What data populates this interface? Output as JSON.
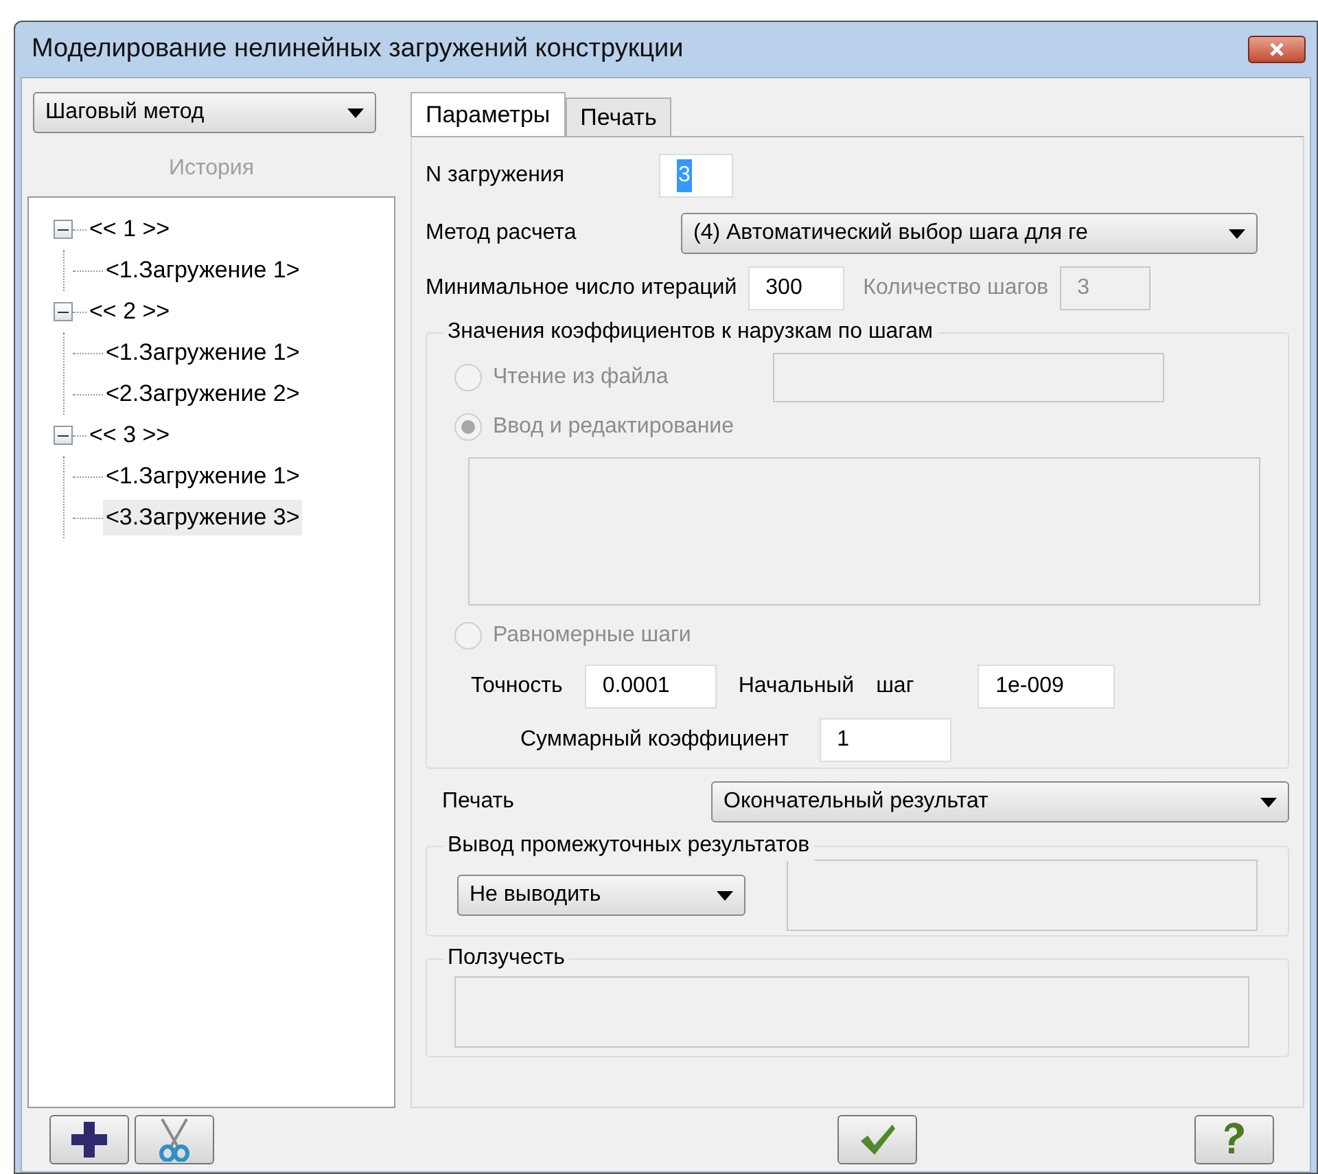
{
  "window": {
    "title": "Моделирование нелинейных загружений конструкции"
  },
  "method_dropdown": {
    "value": "Шаговый метод"
  },
  "history": {
    "label": "История",
    "tree": [
      {
        "label": "<< 1 >>",
        "expanded": true,
        "selected": false,
        "children": [
          {
            "label": "<1.Загружение 1>",
            "selected": false
          }
        ]
      },
      {
        "label": "<< 2 >>",
        "expanded": true,
        "selected": false,
        "children": [
          {
            "label": "<1.Загружение 1>",
            "selected": false
          },
          {
            "label": "<2.Загружение 2>",
            "selected": false
          }
        ]
      },
      {
        "label": "<< 3 >>",
        "expanded": true,
        "selected": false,
        "children": [
          {
            "label": "<1.Загружение 1>",
            "selected": false
          },
          {
            "label": "<3.Загружение 3>",
            "selected": true
          }
        ]
      }
    ]
  },
  "tabs": [
    {
      "label": "Параметры",
      "selected": true
    },
    {
      "label": "Печать",
      "selected": false
    }
  ],
  "params": {
    "load_number": {
      "label": "N загружения",
      "value": "3"
    },
    "calc_method": {
      "label": "Метод расчета",
      "value": "(4) Автоматический выбор шага для ге"
    },
    "min_iterations": {
      "label": "Минимальное число итераций",
      "value": "300"
    },
    "step_count": {
      "label": "Количество шагов",
      "value": "3",
      "disabled": true
    },
    "coefficients_group": {
      "title": "Значения коэффициентов к нарузкам по шагам",
      "options": [
        {
          "label": "Чтение из файла",
          "selected": false,
          "disabled": true
        },
        {
          "label": "Ввод и редактирование",
          "selected": true,
          "disabled": true
        },
        {
          "label": "Равномерные шаги",
          "selected": false,
          "disabled": true
        }
      ]
    },
    "precision": {
      "label": "Точность",
      "value": "0.0001"
    },
    "initial_step": {
      "label_1": "Начальный",
      "label_2": "шаг",
      "value": "1e-009"
    },
    "total_coefficient": {
      "label": "Суммарный коэффициент",
      "value": "1"
    },
    "print": {
      "label": "Печать",
      "value": "Окончательный результат"
    },
    "intermediate_group": {
      "title": "Вывод промежуточных результатов",
      "value": "Не выводить"
    },
    "creep_group": {
      "title": "Ползучесть"
    }
  }
}
